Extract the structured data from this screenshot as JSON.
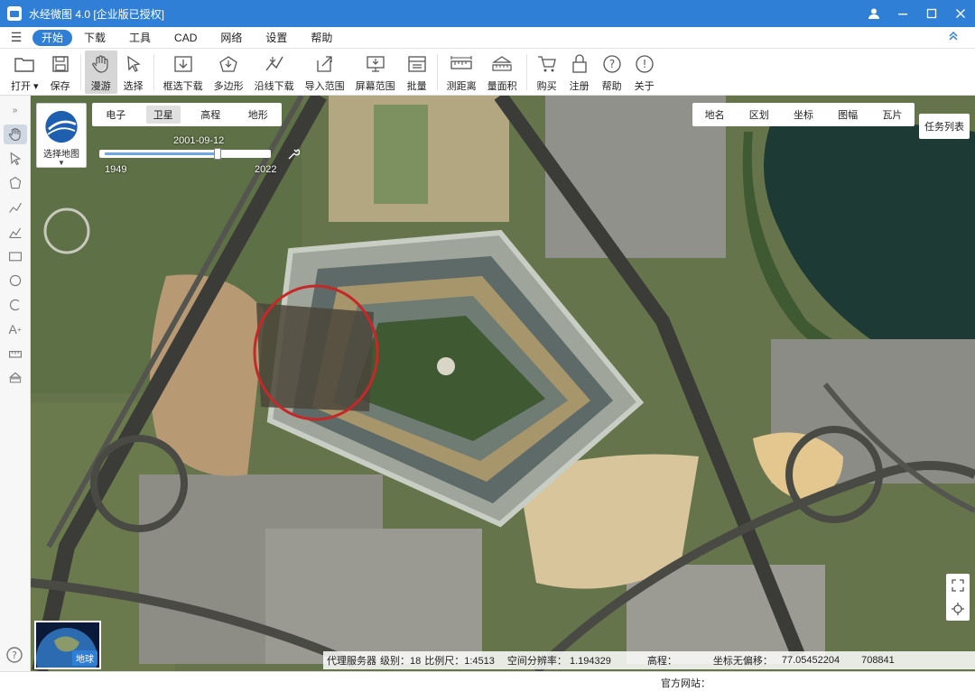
{
  "window": {
    "title": "水经微图 4.0 [企业版已授权]",
    "controls": [
      "user-icon",
      "minimize-icon",
      "restore-icon",
      "close-icon"
    ]
  },
  "menu": {
    "items": [
      "开始",
      "下载",
      "工具",
      "CAD",
      "网络",
      "设置",
      "帮助"
    ],
    "active_index": 0,
    "accent_color": "#2f7fd6"
  },
  "toolbar": {
    "items": [
      {
        "label": "打开 ▾",
        "icon": "folder-icon"
      },
      {
        "label": "保存",
        "icon": "save-icon"
      },
      {
        "label": "漫游",
        "icon": "hand-icon",
        "active": true
      },
      {
        "label": "选择",
        "icon": "cursor-icon"
      },
      {
        "label": "框选下载",
        "icon": "box-download-icon"
      },
      {
        "label": "多边形",
        "icon": "polygon-icon"
      },
      {
        "label": "沿线下载",
        "icon": "line-download-icon"
      },
      {
        "label": "导入范围",
        "icon": "import-icon"
      },
      {
        "label": "屏幕范围",
        "icon": "screen-icon"
      },
      {
        "label": "批量",
        "icon": "batch-icon"
      },
      {
        "label": "测距离",
        "icon": "ruler-icon"
      },
      {
        "label": "量面积",
        "icon": "area-icon"
      },
      {
        "label": "购买",
        "icon": "cart-icon"
      },
      {
        "label": "注册",
        "icon": "lock-icon"
      },
      {
        "label": "帮助",
        "icon": "help-icon"
      },
      {
        "label": "关于",
        "icon": "info-icon"
      }
    ]
  },
  "map": {
    "select_label": "选择地图",
    "basemap_tabs": [
      "电子",
      "卫星",
      "高程",
      "地形"
    ],
    "basemap_active": 1,
    "timeline": {
      "current_date": "2001-09-12",
      "start_year": "1949",
      "end_year": "2022",
      "position_fraction": 0.71
    },
    "overlay_tabs": [
      "地名",
      "区划",
      "坐标",
      "图幅",
      "瓦片"
    ],
    "task_list": "任务列表",
    "mini_globe_label": "地球"
  },
  "status": {
    "proxy": "代理服务器",
    "level": "级别：18",
    "scale": "比例尺：1:4513",
    "resolution": "空间分辨率： 1.194329",
    "elevation": "高程：",
    "offset": "坐标无偏移：",
    "coord_x": "77.05452204",
    "coord_y": "708841"
  },
  "footer": {
    "website_label": "官方网站："
  }
}
